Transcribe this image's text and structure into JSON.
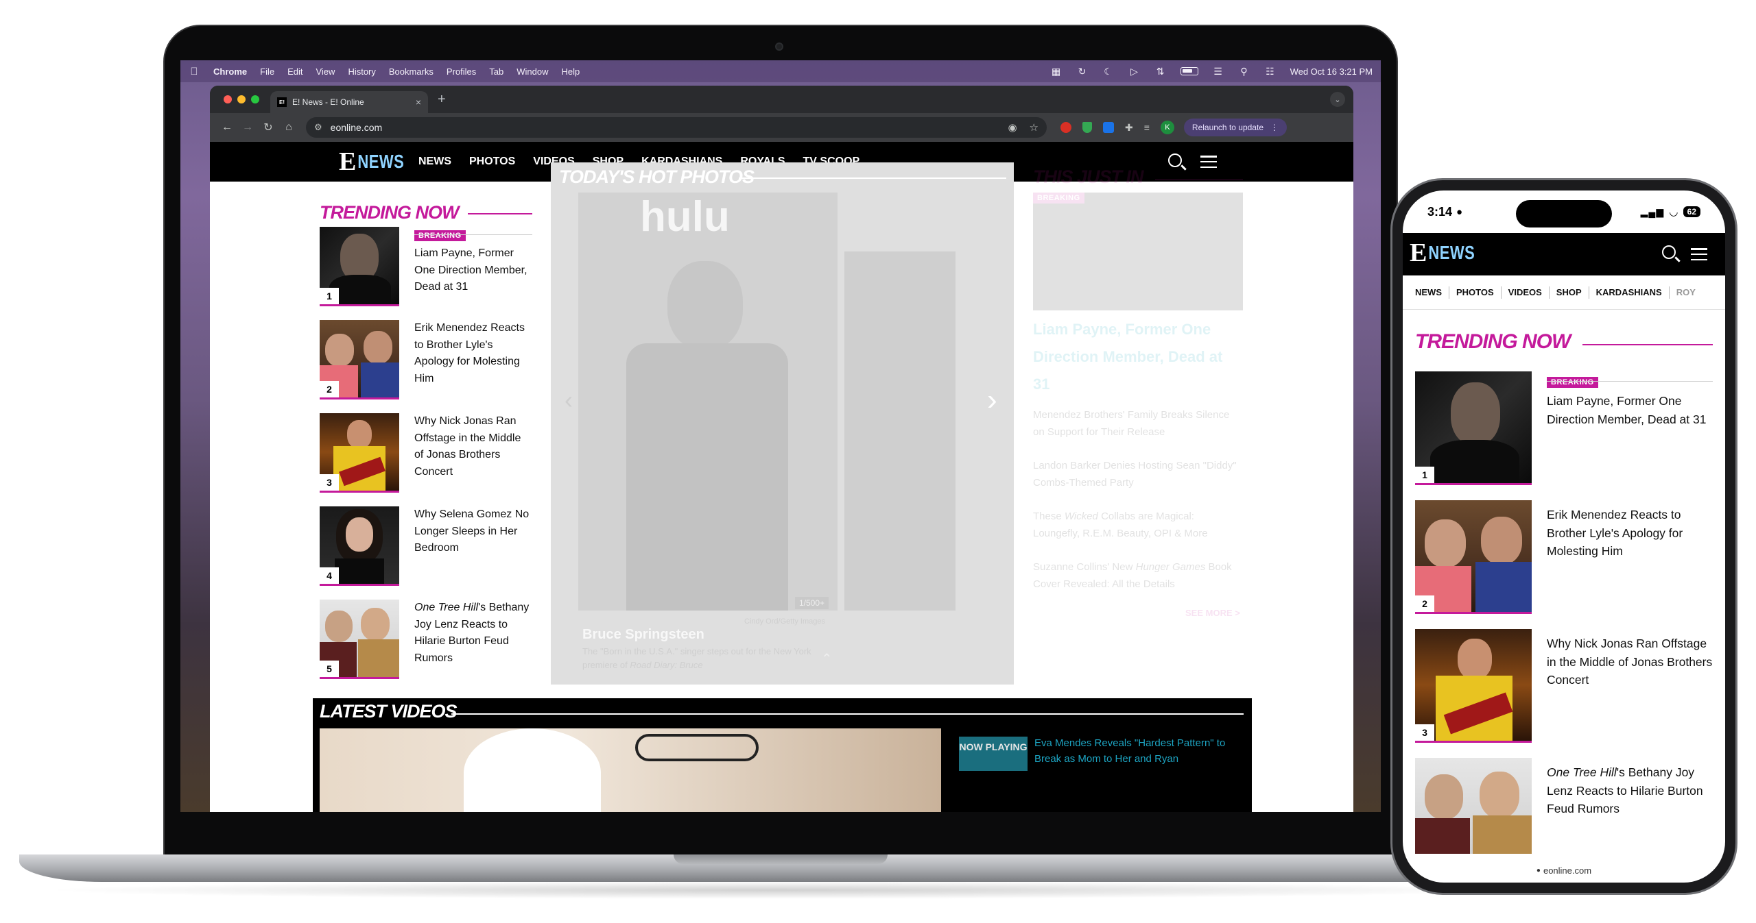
{
  "macos_menubar": {
    "app": "Chrome",
    "menus": [
      "File",
      "Edit",
      "View",
      "History",
      "Bookmarks",
      "Profiles",
      "Tab",
      "Window",
      "Help"
    ],
    "clock": "Wed Oct 16  3:21 PM"
  },
  "browser": {
    "tab_title": "E! News - E! Online",
    "favicon_text": "E!",
    "url": "eonline.com",
    "profile_initial": "K",
    "relaunch_label": "Relaunch to update",
    "close_tab_glyph": "×",
    "new_tab_glyph": "+"
  },
  "site": {
    "logo_e": "E",
    "logo_news": "NEWS",
    "nav": [
      "NEWS",
      "PHOTOS",
      "VIDEOS",
      "SHOP",
      "KARDASHIANS",
      "ROYALS",
      "TV SCOOP"
    ],
    "trending_title": "TRENDING NOW",
    "hot_photos_title": "TODAY'S HOT PHOTOS",
    "hot_photo_brand": "hulu",
    "hot_photo_caption_title": "Bruce Springsteen",
    "hot_photo_caption_pre": "The \"Born in the U.S.A.\" singer steps out for the New York premiere of ",
    "hot_photo_caption_em": "Road Diary: Bruce",
    "hot_photo_credit": "Cindy Ord/Getty Images",
    "hot_photo_counter": "1/500+",
    "this_just_in_title": "THIS JUST IN",
    "breaking_label": "BREAKING",
    "just_in": [
      {
        "headline": "Liam Payne, Former One Direction Member, Dead at 31"
      },
      {
        "headline": "Menendez Brothers' Family Breaks Silence on Support for Their Release"
      },
      {
        "headline": "Landon Barker Denies Hosting Sean \"Diddy\" Combs-Themed Party"
      },
      {
        "pre": "These ",
        "em": "Wicked",
        "post": " Collabs are Magical: Loungefly, R.E.M. Beauty, OPI & More"
      },
      {
        "pre": "Suzanne Collins' New ",
        "em": "Hunger Games",
        "post": " Book Cover Revealed: All the Details"
      }
    ],
    "see_more": "SEE MORE >",
    "latest_videos_title": "LATEST VIDEOS",
    "now_playing": "NOW PLAYING",
    "now_playing_headline": "Eva Mendes Reveals \"Hardest Pattern\" to Break as Mom to Her and Ryan",
    "trending": [
      {
        "rank": "1",
        "badge": "BREAKING",
        "title": "Liam Payne, Former One Direction Member, Dead at 31"
      },
      {
        "rank": "2",
        "title": "Erik Menendez Reacts to Brother Lyle's Apology for Molesting Him"
      },
      {
        "rank": "3",
        "title": "Why Nick Jonas Ran Offstage in the Middle of Jonas Brothers Concert"
      },
      {
        "rank": "4",
        "title": "Why Selena Gomez No Longer Sleeps in Her Bedroom"
      },
      {
        "rank": "5",
        "title_em": "One Tree Hill",
        "title_rest": "'s Bethany Joy Lenz Reacts to Hilarie Burton Feud Rumors"
      }
    ]
  },
  "phone": {
    "time": "3:14",
    "battery": "62",
    "nav": [
      "NEWS",
      "PHOTOS",
      "VIDEOS",
      "SHOP",
      "KARDASHIANS",
      "ROY"
    ],
    "url": "eonline.com"
  },
  "colors": {
    "brand_magenta": "#c41a9b",
    "nav_black": "#000000",
    "now_playing_teal": "#1d7a8c"
  }
}
